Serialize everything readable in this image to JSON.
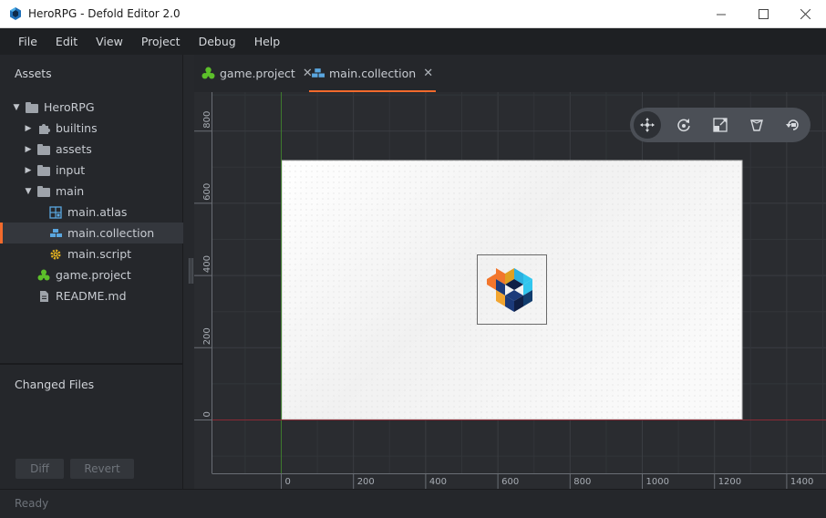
{
  "window": {
    "title": "HeroRPG - Defold Editor 2.0"
  },
  "menu": [
    "File",
    "Edit",
    "View",
    "Project",
    "Debug",
    "Help"
  ],
  "assets": {
    "heading": "Assets",
    "tree": [
      {
        "label": "HeroRPG",
        "icon": "folder-icon",
        "expanded": true
      },
      {
        "label": "builtins",
        "icon": "puzzle-icon",
        "expanded": false
      },
      {
        "label": "assets",
        "icon": "folder-icon",
        "expanded": false
      },
      {
        "label": "input",
        "icon": "folder-icon",
        "expanded": false
      },
      {
        "label": "main",
        "icon": "folder-icon",
        "expanded": true
      },
      {
        "label": "main.atlas",
        "icon": "atlas-icon"
      },
      {
        "label": "main.collection",
        "icon": "collection-icon",
        "selected": true
      },
      {
        "label": "main.script",
        "icon": "gear-icon"
      },
      {
        "label": "game.project",
        "icon": "defold-project-icon"
      },
      {
        "label": "README.md",
        "icon": "document-icon"
      }
    ]
  },
  "changed_files": {
    "heading": "Changed Files",
    "diff_label": "Diff",
    "revert_label": "Revert"
  },
  "tabs": [
    {
      "label": "game.project",
      "icon": "defold-project-icon",
      "active": false
    },
    {
      "label": "main.collection",
      "icon": "collection-icon",
      "active": true
    }
  ],
  "scene": {
    "x_ticks": [
      "0",
      "200",
      "400",
      "600",
      "800",
      "1000",
      "1200",
      "1400"
    ],
    "y_ticks": [
      "0",
      "200",
      "400",
      "600",
      "800"
    ],
    "tools": [
      "move-icon",
      "rotate-icon",
      "scale-icon",
      "perspective-icon",
      "camera-reset-icon"
    ]
  },
  "status": {
    "text": "Ready"
  },
  "colors": {
    "accent": "#f26a2c",
    "x_axis": "#8a2a35",
    "y_axis": "#3e7a2e"
  }
}
